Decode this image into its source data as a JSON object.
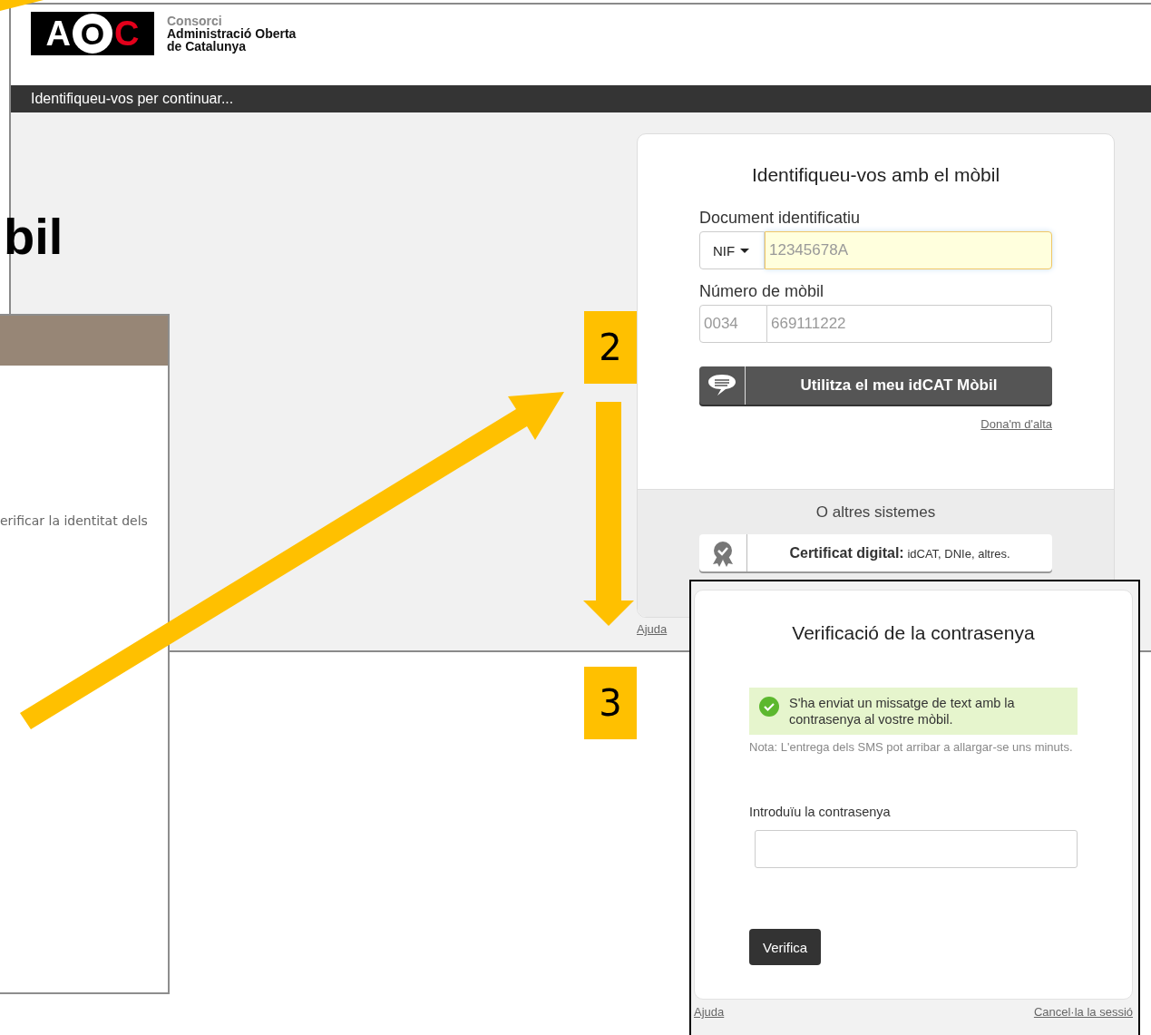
{
  "background_page": {
    "logo": {
      "letters": [
        "A",
        "O",
        "C"
      ],
      "consorci": "Consorci",
      "name_line1": "Administració Oberta",
      "name_line2": "de Catalunya"
    },
    "title_bar": "Identifiqueu-vos per continuar...",
    "login_card": {
      "title": "Identifiqueu-vos amb el mòbil",
      "document_label": "Document identificatiu",
      "document_type": "NIF",
      "document_placeholder": "12345678A",
      "mobile_label": "Número de mòbil",
      "prefix_placeholder": "0034",
      "mobile_placeholder": "669111222",
      "mobile_button": "Utilitza el meu idCAT Mòbil",
      "signup_link": "Dona'm d'alta",
      "other_systems": "O altres sistemes",
      "certificate_label": "Certificat digital:",
      "certificate_detail": "idCAT, DNIe, altres."
    },
    "help_link": "Ajuda"
  },
  "partial_heading": "bil",
  "side_panel": {
    "text": "erificar la identitat dels"
  },
  "step_labels": [
    "2",
    "3"
  ],
  "verification_window": {
    "title": "Verificació de la contrasenya",
    "success_message": "S'ha enviat un missatge de text amb la contrasenya al vostre mòbil.",
    "note": "Nota: L'entrega dels SMS pot arribar a allargar-se uns minuts.",
    "password_label": "Introduïu la contrasenya",
    "verify_button": "Verifica",
    "help_link": "Ajuda",
    "cancel_link": "Cancel·la la sessió"
  }
}
